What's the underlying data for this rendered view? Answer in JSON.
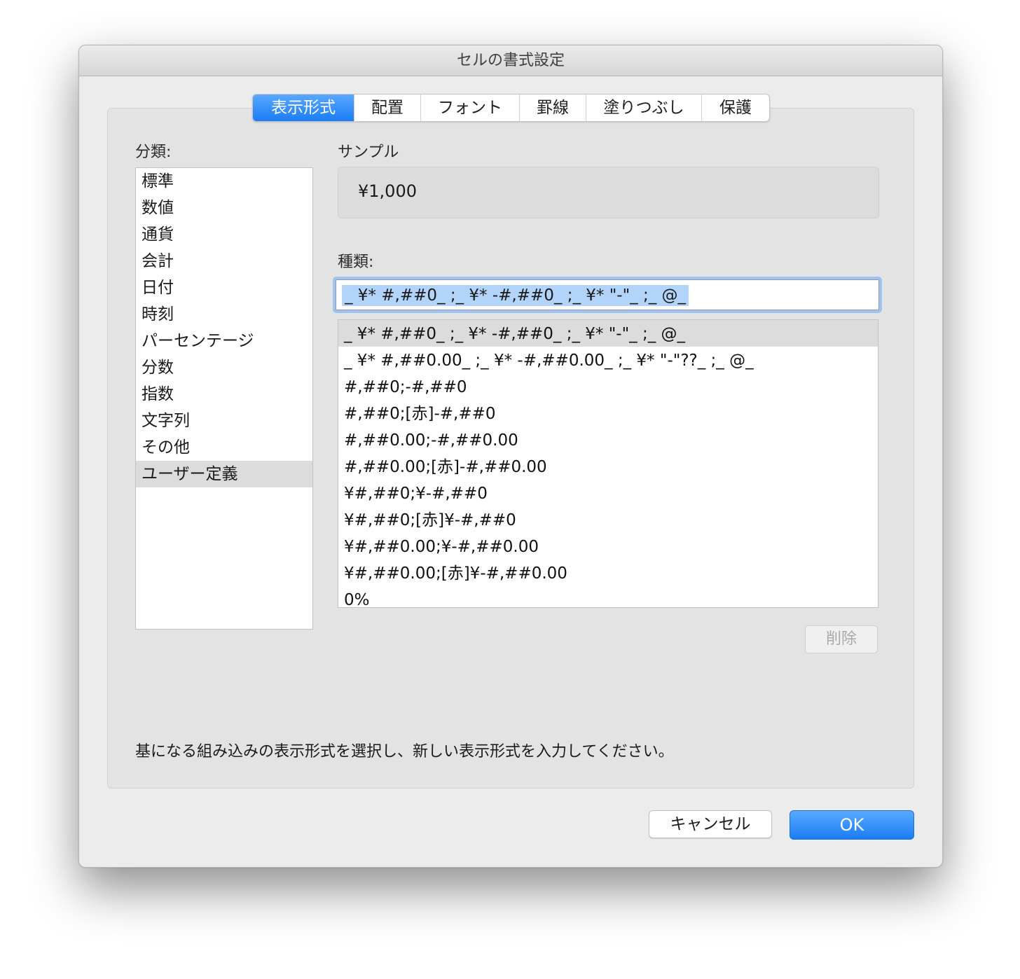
{
  "window": {
    "title": "セルの書式設定"
  },
  "tabs": [
    {
      "label": "表示形式",
      "active": true
    },
    {
      "label": "配置"
    },
    {
      "label": "フォント"
    },
    {
      "label": "罫線"
    },
    {
      "label": "塗りつぶし"
    },
    {
      "label": "保護"
    }
  ],
  "category": {
    "label": "分類:",
    "items": [
      "標準",
      "数値",
      "通貨",
      "会計",
      "日付",
      "時刻",
      "パーセンテージ",
      "分数",
      "指数",
      "文字列",
      "その他",
      "ユーザー定義"
    ],
    "selected": "ユーザー定義"
  },
  "sample": {
    "label": "サンプル",
    "value": "¥1,000"
  },
  "type": {
    "label": "種類:",
    "input_value": "_ ¥* #,##0_ ;_ ¥* -#,##0_ ;_ ¥* \"-\"_ ;_ @_",
    "formats": [
      "_ ¥* #,##0_ ;_ ¥* -#,##0_ ;_ ¥* \"-\"_ ;_ @_",
      "_ ¥* #,##0.00_ ;_ ¥* -#,##0.00_ ;_ ¥* \"-\"??_ ;_ @_",
      "#,##0;-#,##0",
      "#,##0;[赤]-#,##0",
      "#,##0.00;-#,##0.00",
      "#,##0.00;[赤]-#,##0.00",
      "¥#,##0;¥-#,##0",
      "¥#,##0;[赤]¥-#,##0",
      "¥#,##0.00;¥-#,##0.00",
      "¥#,##0.00;[赤]¥-#,##0.00",
      "0%"
    ]
  },
  "buttons": {
    "delete": "削除",
    "cancel": "キャンセル",
    "ok": "OK"
  },
  "hint": "基になる組み込みの表示形式を選択し、新しい表示形式を入力してください。",
  "colors": {
    "accent": "#1b7cf4",
    "selection": "#b2d4fb"
  }
}
